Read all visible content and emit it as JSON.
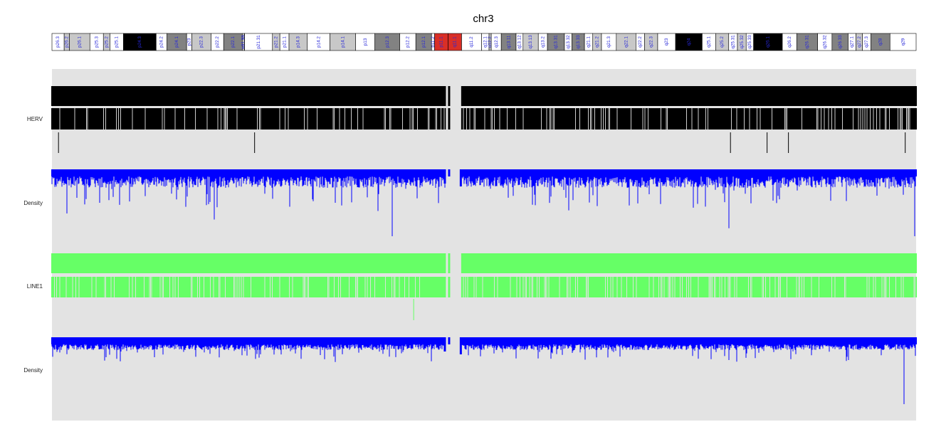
{
  "chart_data": {
    "type": "genome-track",
    "title": "chr3",
    "ideogram": {
      "bands": [
        {
          "name": "p26.3",
          "end": 2.8,
          "stain": "gneg"
        },
        {
          "name": "p26.2",
          "end": 4.0,
          "stain": "gpos25"
        },
        {
          "name": "p26.1",
          "end": 8.7,
          "stain": "gpos50"
        },
        {
          "name": "p25.3",
          "end": 11.8,
          "stain": "gneg"
        },
        {
          "name": "p25.2",
          "end": 13.3,
          "stain": "gpos25"
        },
        {
          "name": "p25.1",
          "end": 16.4,
          "stain": "gneg"
        },
        {
          "name": "p24.3",
          "end": 23.9,
          "stain": "gpos100"
        },
        {
          "name": "p24.2",
          "end": 26.4,
          "stain": "gneg"
        },
        {
          "name": "p24.1",
          "end": 30.9,
          "stain": "gpos75"
        },
        {
          "name": "p23",
          "end": 32.1,
          "stain": "gneg"
        },
        {
          "name": "p22.3",
          "end": 36.5,
          "stain": "gpos50"
        },
        {
          "name": "p22.2",
          "end": 39.4,
          "stain": "gneg"
        },
        {
          "name": "p22.1",
          "end": 43.7,
          "stain": "gpos75"
        },
        {
          "name": "p21.33",
          "end": 44.1,
          "stain": "gneg"
        },
        {
          "name": "p21.32",
          "end": 44.2,
          "stain": "gpos50"
        },
        {
          "name": "p21.31",
          "end": 50.6,
          "stain": "gneg"
        },
        {
          "name": "p21.2",
          "end": 52.3,
          "stain": "gpos25"
        },
        {
          "name": "p21.1",
          "end": 54.4,
          "stain": "gneg"
        },
        {
          "name": "p14.3",
          "end": 58.6,
          "stain": "gpos50"
        },
        {
          "name": "p14.2",
          "end": 63.8,
          "stain": "gneg"
        },
        {
          "name": "p14.1",
          "end": 69.7,
          "stain": "gpos50"
        },
        {
          "name": "p13",
          "end": 74.1,
          "stain": "gneg"
        },
        {
          "name": "p12.3",
          "end": 79.8,
          "stain": "gpos75"
        },
        {
          "name": "p12.2",
          "end": 83.5,
          "stain": "gneg"
        },
        {
          "name": "p12.1",
          "end": 87.1,
          "stain": "gpos75"
        },
        {
          "name": "p11.2",
          "end": 87.8,
          "stain": "gneg"
        },
        {
          "name": "p11.1",
          "end": 90.9,
          "stain": "acen"
        },
        {
          "name": "q11.1",
          "end": 94.0,
          "stain": "acen"
        },
        {
          "name": "q11.2",
          "end": 98.6,
          "stain": "gvar"
        },
        {
          "name": "q12.1",
          "end": 100.3,
          "stain": "gneg"
        },
        {
          "name": "q12.2",
          "end": 100.8,
          "stain": "gpos25"
        },
        {
          "name": "q12.3",
          "end": 103.1,
          "stain": "gneg"
        },
        {
          "name": "q13.11",
          "end": 106.5,
          "stain": "gpos75"
        },
        {
          "name": "q13.12",
          "end": 108.1,
          "stain": "gneg"
        },
        {
          "name": "q13.13",
          "end": 111.6,
          "stain": "gpos50"
        },
        {
          "name": "q13.2",
          "end": 113.7,
          "stain": "gneg"
        },
        {
          "name": "q13.31",
          "end": 117.6,
          "stain": "gpos75"
        },
        {
          "name": "q13.32",
          "end": 119.3,
          "stain": "gneg"
        },
        {
          "name": "q13.33",
          "end": 122.2,
          "stain": "gpos75"
        },
        {
          "name": "q21.1",
          "end": 124.1,
          "stain": "gneg"
        },
        {
          "name": "q21.2",
          "end": 126.1,
          "stain": "gpos25"
        },
        {
          "name": "q21.3",
          "end": 129.5,
          "stain": "gneg"
        },
        {
          "name": "q22.1",
          "end": 134.0,
          "stain": "gpos25"
        },
        {
          "name": "q22.2",
          "end": 136.0,
          "stain": "gneg"
        },
        {
          "name": "q22.3",
          "end": 139.0,
          "stain": "gpos25"
        },
        {
          "name": "q23",
          "end": 143.1,
          "stain": "gneg"
        },
        {
          "name": "q24",
          "end": 149.2,
          "stain": "gpos100"
        },
        {
          "name": "q25.1",
          "end": 152.3,
          "stain": "gneg"
        },
        {
          "name": "q25.2",
          "end": 155.3,
          "stain": "gpos50"
        },
        {
          "name": "q25.31",
          "end": 157.3,
          "stain": "gneg"
        },
        {
          "name": "q25.32",
          "end": 159.3,
          "stain": "gpos50"
        },
        {
          "name": "q25.33",
          "end": 161.0,
          "stain": "gneg"
        },
        {
          "name": "q26.1",
          "end": 167.6,
          "stain": "gpos100"
        },
        {
          "name": "q26.2",
          "end": 170.9,
          "stain": "gneg"
        },
        {
          "name": "q26.31",
          "end": 175.7,
          "stain": "gpos75"
        },
        {
          "name": "q26.32",
          "end": 179.0,
          "stain": "gneg"
        },
        {
          "name": "q26.33",
          "end": 182.7,
          "stain": "gpos75"
        },
        {
          "name": "q27.1",
          "end": 184.5,
          "stain": "gneg"
        },
        {
          "name": "q27.2",
          "end": 186.0,
          "stain": "gpos25"
        },
        {
          "name": "q27.3",
          "end": 187.9,
          "stain": "gneg"
        },
        {
          "name": "q28",
          "end": 192.3,
          "stain": "gpos75"
        },
        {
          "name": "q29",
          "end": 198.3,
          "stain": "gneg"
        }
      ]
    },
    "centromere_gap": [
      90.4,
      93.9
    ],
    "tracks": [
      {
        "label": "HERV",
        "color": "#000000",
        "density_label": "Density",
        "density_color": "#0000ff",
        "long_insertions": [
          1.5,
          46.5,
          155.7,
          164.1,
          169.0,
          195.8
        ],
        "density_deep_dips": [
          {
            "pos": 78.1,
            "depth": 1.0
          },
          {
            "pos": 155.4,
            "depth": 0.88
          },
          {
            "pos": 198.0,
            "depth": 1.0
          },
          {
            "pos": 37.3,
            "depth": 0.75
          },
          {
            "pos": 3.4,
            "depth": 0.66
          }
        ]
      },
      {
        "label": "LINE1",
        "color": "#66ff66",
        "density_label": "Density",
        "density_color": "#0000ff",
        "long_insertions": [
          83.0
        ],
        "density_deep_dips": [
          {
            "pos": 195.5,
            "depth": 1.0
          },
          {
            "pos": 15.6,
            "depth": 0.36
          },
          {
            "pos": 125.0,
            "depth": 0.3
          }
        ]
      }
    ],
    "stain_colors": {
      "gneg": "#ffffff",
      "gpos25": "#c8c8c8",
      "gpos50": "#c8c8c8",
      "gpos75": "#828282",
      "gpos100": "#000000",
      "gvar": "#ffffff",
      "acen": "#d92f27"
    }
  }
}
